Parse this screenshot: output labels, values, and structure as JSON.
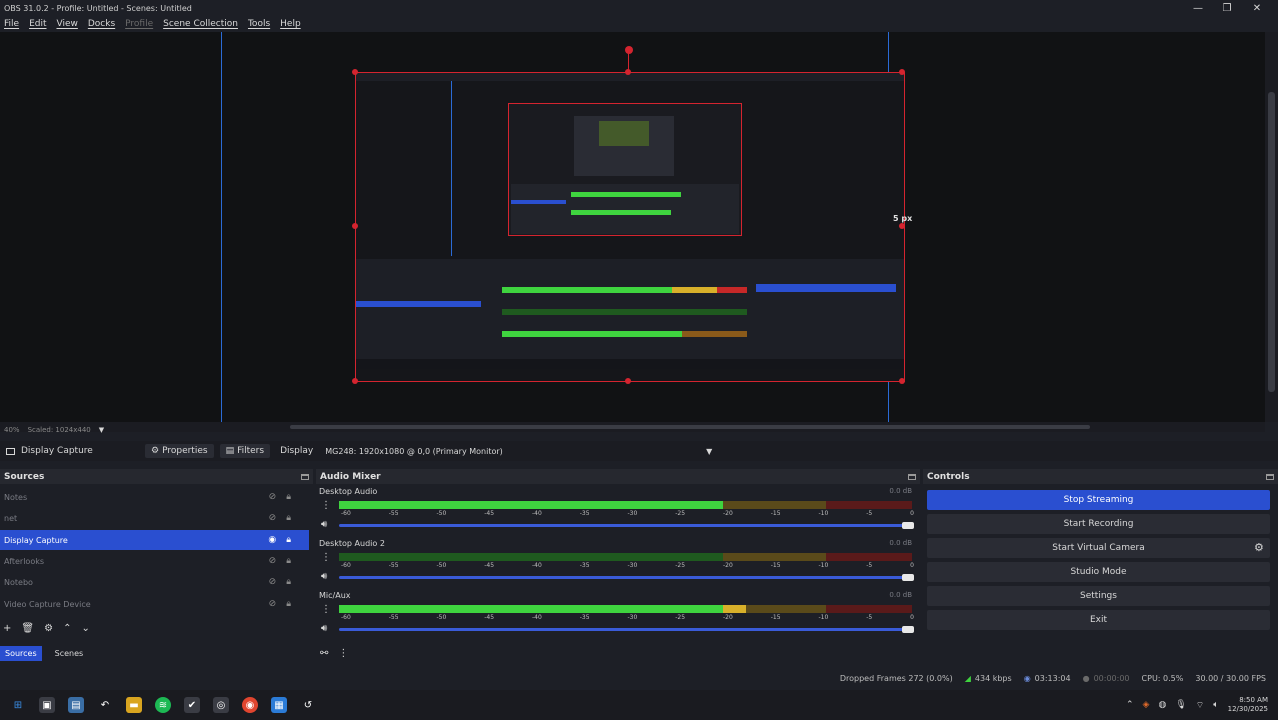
{
  "window": {
    "title": "OBS 31.0.2 - Profile: Untitled - Scenes: Untitled",
    "minimize": "—",
    "maximize": "❐",
    "close": "✕"
  },
  "menu": [
    {
      "label": "File"
    },
    {
      "label": "Edit"
    },
    {
      "label": "View"
    },
    {
      "label": "Docks"
    },
    {
      "label": "Profile"
    },
    {
      "label": "Scene Collection"
    },
    {
      "label": "Tools"
    },
    {
      "label": "Help"
    }
  ],
  "preview": {
    "size_label": "5 px",
    "zoom": "40%",
    "scale": "Scaled: 1024x440"
  },
  "context_bar": {
    "source_name": "Display Capture",
    "properties_label": "Properties",
    "filters_label": "Filters",
    "display_label": "Display",
    "display_value": "MG248: 1920x1080 @ 0,0 (Primary Monitor)"
  },
  "sources": {
    "header": "Sources",
    "items": [
      {
        "label": "Notes"
      },
      {
        "label": "net"
      },
      {
        "label": "Display Capture"
      },
      {
        "label": "Afterlooks"
      },
      {
        "label": "Notebo"
      },
      {
        "label": "Video Capture Device"
      }
    ],
    "tabs": [
      {
        "label": "Sources"
      },
      {
        "label": "Scenes"
      }
    ]
  },
  "mixer": {
    "header": "Audio Mixer",
    "channels": [
      {
        "name": "Desktop Audio",
        "db": "0.0 dB",
        "level": 0.67
      },
      {
        "name": "Desktop Audio 2",
        "db": "0.0 dB",
        "level": 0.0
      },
      {
        "name": "Mic/Aux",
        "db": "0.0 dB",
        "level": 0.71
      }
    ],
    "tick_labels": [
      "-60",
      "-55",
      "-50",
      "-45",
      "-40",
      "-35",
      "-30",
      "-25",
      "-20",
      "-15",
      "-10",
      "-5",
      "0"
    ]
  },
  "controls": {
    "header": "Controls",
    "buttons": [
      {
        "label": "Stop Streaming"
      },
      {
        "label": "Start Recording"
      },
      {
        "label": "Start Virtual Camera"
      },
      {
        "label": "Studio Mode"
      },
      {
        "label": "Settings"
      },
      {
        "label": "Exit"
      }
    ]
  },
  "status": {
    "dropped_frames": "Dropped Frames 272 (0.0%)",
    "bitrate": "434 kbps",
    "stream_time": "03:13:04",
    "rec_time": "00:00:00",
    "cpu": "CPU: 0.5%",
    "fps": "30.00 / 30.00 FPS"
  },
  "taskbar": {
    "time": "8:50 AM",
    "date": "12/30/2025"
  },
  "colors": {
    "accent": "#2a4fd0",
    "selection_red": "#d4242f",
    "meter_green": "#3fd43f",
    "meter_yellow": "#d8b02a",
    "meter_red": "#c62828"
  }
}
